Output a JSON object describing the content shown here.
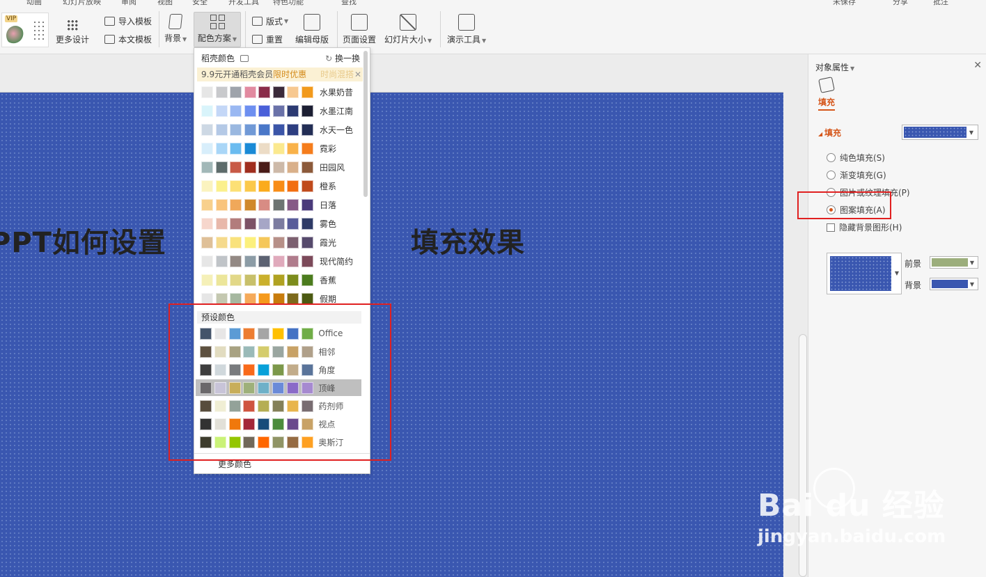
{
  "menu": {
    "items": [
      "动画",
      "幻灯片放映",
      "审阅",
      "视图",
      "安全",
      "开发工具",
      "特色功能",
      "查找"
    ],
    "right": [
      "未保存",
      "分享",
      "批注"
    ]
  },
  "ribbon": {
    "more_design": "更多设计",
    "import_template": "导入模板",
    "text_template": "本文模板",
    "background": "背景",
    "color_scheme": "配色方案",
    "layout": "版式",
    "reset": "重置",
    "edit_master": "编辑母版",
    "page_setup": "页面设置",
    "slide_size": "幻灯片大小",
    "presentation_tools": "演示工具",
    "vip_badge": "VIP"
  },
  "dropdown": {
    "header": "稻壳颜色",
    "refresh": "换一换",
    "promo_prefix": "9.9元开通稻壳会员",
    "promo_highlight": "限时优惠",
    "promo_fade": "时尚混搭",
    "themes": [
      {
        "name": "水果奶昔",
        "colors": [
          "#e6e6e6",
          "#c8c9cc",
          "#9ea3ab",
          "#e28aa0",
          "#8a2c4a",
          "#3b2a3a",
          "#f7c890",
          "#f29a1c"
        ]
      },
      {
        "name": "水墨江南",
        "colors": [
          "#d9f4fb",
          "#c4d7f7",
          "#9ab8f2",
          "#6d8ff0",
          "#4a60d9",
          "#6a72a9",
          "#2c3a72",
          "#1c1f33"
        ]
      },
      {
        "name": "水天一色",
        "colors": [
          "#cdd8e4",
          "#b4c9e6",
          "#9ab8e0",
          "#7099d6",
          "#4a77c8",
          "#3b55a8",
          "#2d3e80",
          "#232e55"
        ]
      },
      {
        "name": "霓彩",
        "colors": [
          "#d8eefb",
          "#a9d6f7",
          "#6bbcf0",
          "#1a8ad6",
          "#ecdcc6",
          "#fbe98f",
          "#f9b24a",
          "#f57d1c"
        ]
      },
      {
        "name": "田园风",
        "colors": [
          "#a2b8b8",
          "#5e6c6b",
          "#c85a46",
          "#a02e1e",
          "#4a1c18",
          "#cdb9a8",
          "#d9b08a",
          "#8c5a3a"
        ]
      },
      {
        "name": "橙系",
        "colors": [
          "#fbf3bf",
          "#fbf08c",
          "#fce075",
          "#fbc94a",
          "#fbab1c",
          "#f88c16",
          "#f26e10",
          "#c04a1c"
        ]
      },
      {
        "name": "日落",
        "colors": [
          "#f8d08c",
          "#f9c47c",
          "#f0a85a",
          "#d0882a",
          "#d88c84",
          "#6d7472",
          "#865a86",
          "#4a3a7a"
        ]
      },
      {
        "name": "雾色",
        "colors": [
          "#f6d6cc",
          "#e8b8aa",
          "#b27c7c",
          "#7c5266",
          "#a6a6c6",
          "#7c7ca0",
          "#585c9a",
          "#2e3a66"
        ]
      },
      {
        "name": "霞光",
        "colors": [
          "#dfc098",
          "#f5da8c",
          "#f9e27c",
          "#fcf07c",
          "#f5c75a",
          "#b79088",
          "#7c6070",
          "#564a6c"
        ]
      },
      {
        "name": "现代简约",
        "colors": [
          "#e6e6e6",
          "#c0c4c8",
          "#938984",
          "#8c9ca6",
          "#5c6272",
          "#e0aabc",
          "#b07c8c",
          "#7c4a5a"
        ]
      },
      {
        "name": "香蕉",
        "colors": [
          "#f5f0b8",
          "#ece69a",
          "#e2d888",
          "#c8c06a",
          "#cab02c",
          "#b0a222",
          "#7c8c1c",
          "#4c7c1e"
        ]
      },
      {
        "name": "假期",
        "colors": [
          "#e6e6e6",
          "#c4c8b0",
          "#a6b8a0",
          "#f5aa5a",
          "#f59a1c",
          "#c87c0c",
          "#7c6a1c",
          "#4c5a12"
        ]
      }
    ],
    "preset_header": "预设颜色",
    "presets": [
      {
        "name": "Office",
        "colors": [
          "#44546a",
          "#e7e6e6",
          "#5b9bd5",
          "#ed7d31",
          "#a5a5a5",
          "#ffc000",
          "#4472c4",
          "#70ad47"
        ],
        "selected": false
      },
      {
        "name": "相邻",
        "colors": [
          "#5e5140",
          "#e2dcc0",
          "#a8a282",
          "#9abab8",
          "#d4cc6c",
          "#9aa6a0",
          "#c8a266",
          "#b0a08a"
        ],
        "selected": false
      },
      {
        "name": "角度",
        "colors": [
          "#3e3e3e",
          "#d0d8dc",
          "#797b7e",
          "#f96a1b",
          "#08a1d9",
          "#7c984a",
          "#c2ac8a",
          "#5a749a"
        ],
        "selected": false
      },
      {
        "name": "顶峰",
        "colors": [
          "#6a686a",
          "#c8c4d8",
          "#c8ae5a",
          "#9eb07a",
          "#6eb0c8",
          "#6a8ad8",
          "#8a6ac8",
          "#a68ad0"
        ],
        "selected": true
      },
      {
        "name": "药剂师",
        "colors": [
          "#574c3c",
          "#f0eed4",
          "#93a299",
          "#cf543f",
          "#b5ae53",
          "#848058",
          "#e8b54d",
          "#786c71"
        ],
        "selected": false
      },
      {
        "name": "视点",
        "colors": [
          "#323232",
          "#e2e0d8",
          "#f0780c",
          "#a42638",
          "#184c7a",
          "#4c8c3c",
          "#6a4a8c",
          "#c8a266"
        ],
        "selected": false
      },
      {
        "name": "奥斯汀",
        "colors": [
          "#3e3d2d",
          "#caf278",
          "#94c600",
          "#71685a",
          "#ff6700",
          "#909465",
          "#956b43",
          "#fea022"
        ],
        "selected": false
      }
    ],
    "more_colors": "更多颜色"
  },
  "slide": {
    "title": "PPT如何设置",
    "title_tail": "填充效果"
  },
  "panel": {
    "title": "对象属性",
    "tab_fill": "填充",
    "section_fill": "填充",
    "fill_color": "#3a57b0",
    "options": [
      {
        "label": "纯色填充(S)",
        "checked": false
      },
      {
        "label": "渐变填充(G)",
        "checked": false
      },
      {
        "label": "图片或纹理填充(P)",
        "checked": false
      },
      {
        "label": "图案填充(A)",
        "checked": true
      }
    ],
    "hide_bg_label": "隐藏背景图形(H)",
    "foreground_label": "前景",
    "background_label": "背景",
    "foreground_color": "#9cae7c",
    "background_color": "#3a57b0"
  },
  "watermark": {
    "logo": "Bai du 经验",
    "url": "jingyan.baidu.com"
  }
}
